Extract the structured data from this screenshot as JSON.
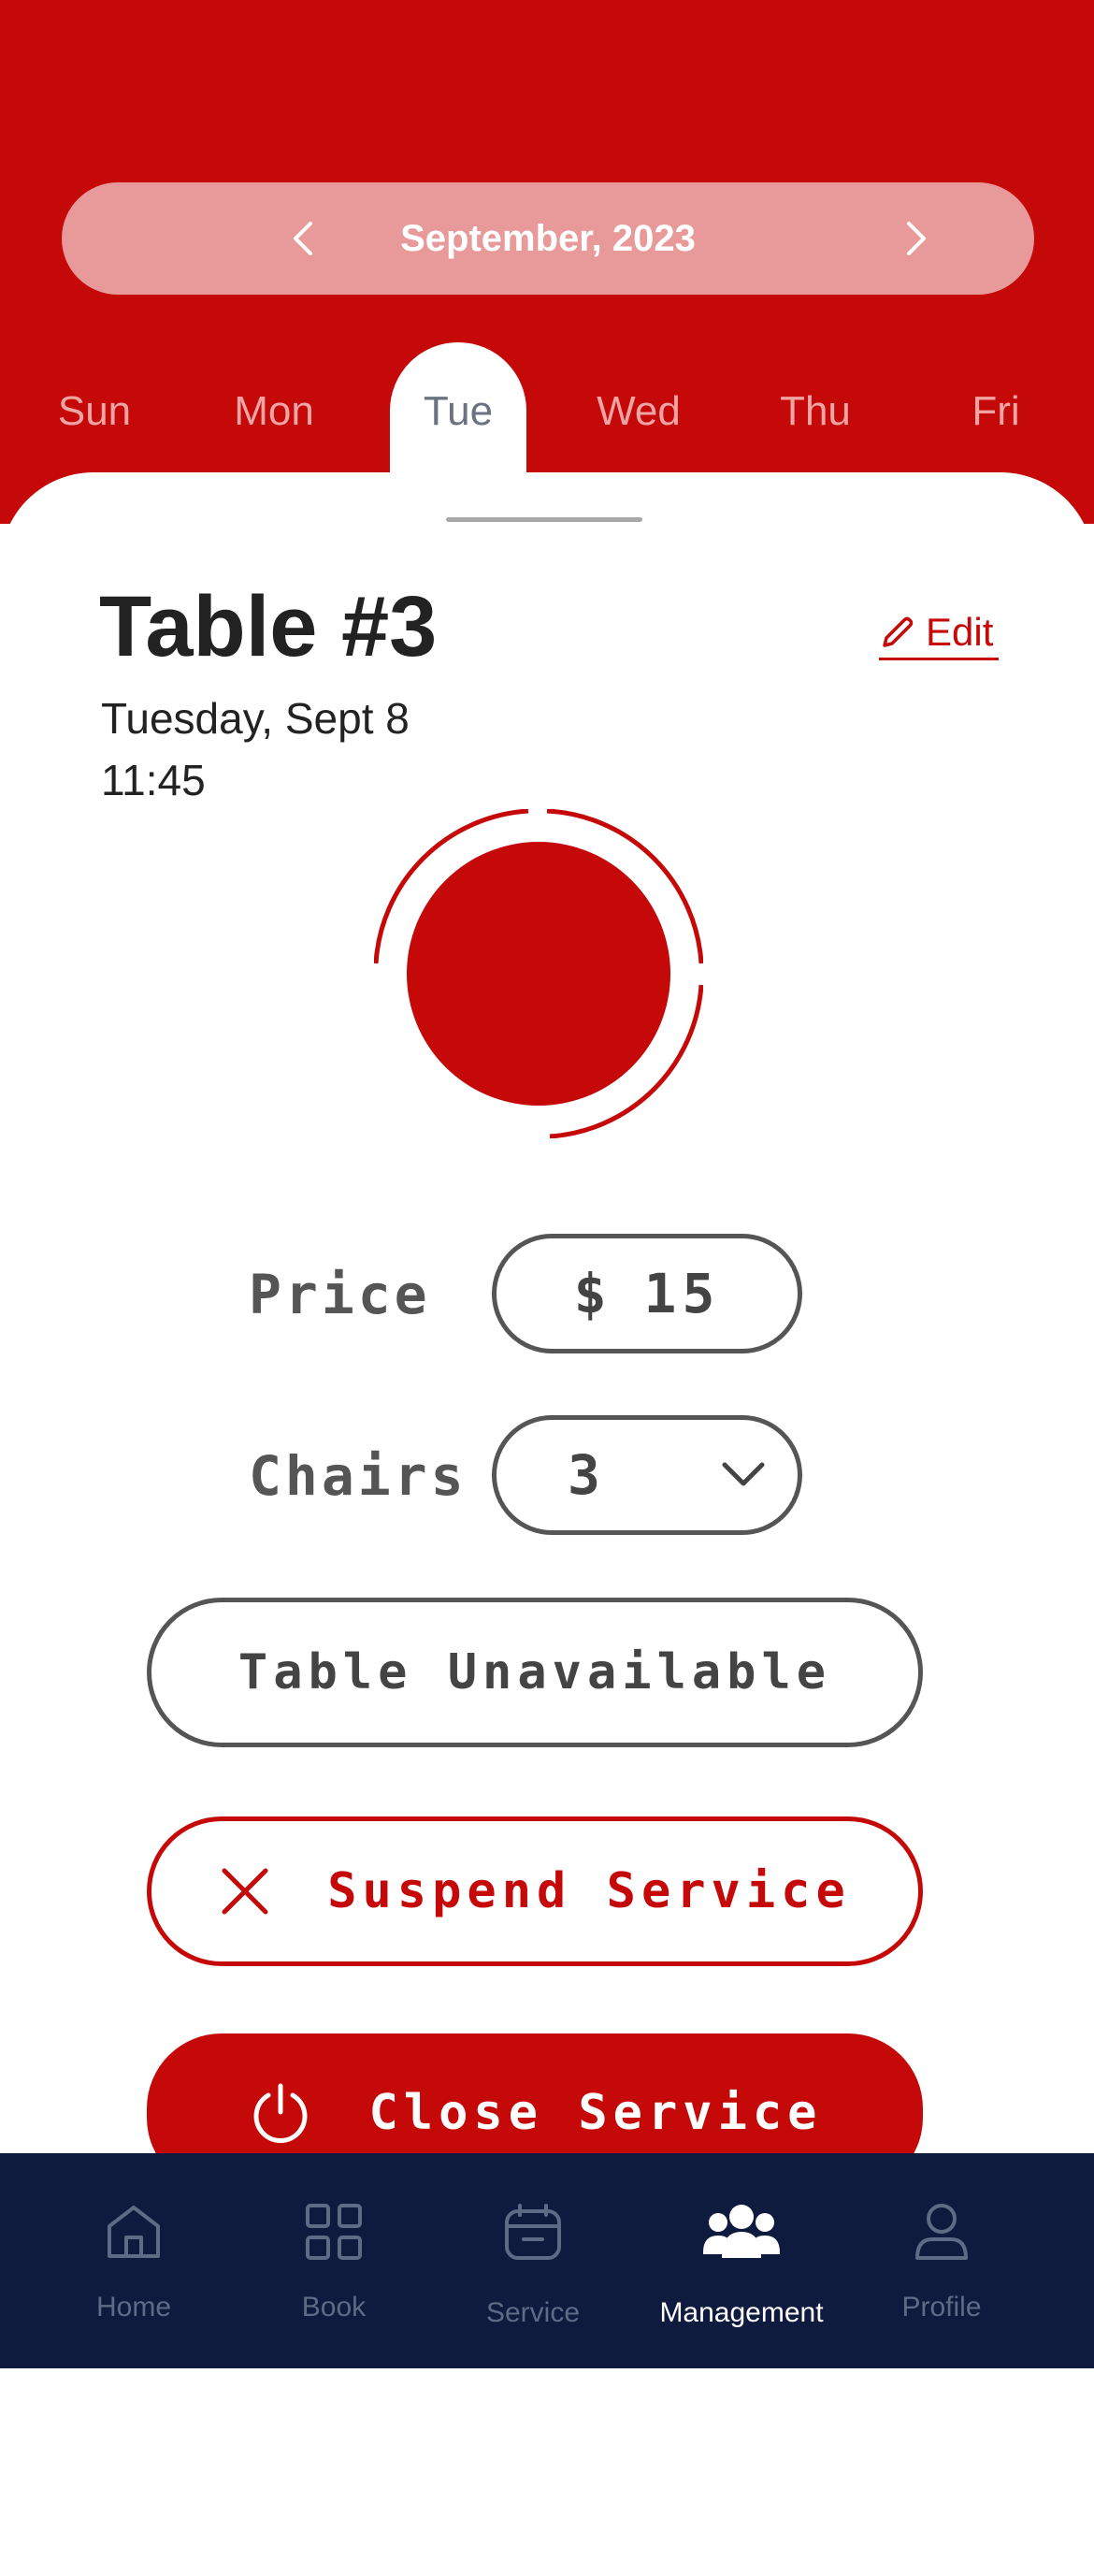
{
  "calendar": {
    "month_label": "September, 2023",
    "days": [
      "Sun",
      "Mon",
      "Tue",
      "Wed",
      "Thu",
      "Fri"
    ],
    "selected_day": "Tue"
  },
  "detail": {
    "title": "Table #3",
    "edit_label": "Edit",
    "date": "Tuesday, Sept 8",
    "time": "11:45"
  },
  "form": {
    "price_label": "Price",
    "price_currency": "$",
    "price_value": "15",
    "chairs_label": "Chairs",
    "chairs_value": "3"
  },
  "actions": {
    "unavailable_label": "Table Unavailable",
    "suspend_label": "Suspend Service",
    "close_label": "Close Service"
  },
  "bottom_nav": {
    "items": [
      {
        "label": "Home",
        "icon": "home-icon"
      },
      {
        "label": "Book",
        "icon": "grid-icon"
      },
      {
        "label": "Service",
        "icon": "calendar-icon"
      },
      {
        "label": "Management",
        "icon": "group-icon"
      },
      {
        "label": "Profile",
        "icon": "user-icon"
      }
    ],
    "active": "Management"
  },
  "colors": {
    "brand_red": "#c50808",
    "nav_bg": "#0e1a3e",
    "pill_bg": "#e89a9a"
  }
}
